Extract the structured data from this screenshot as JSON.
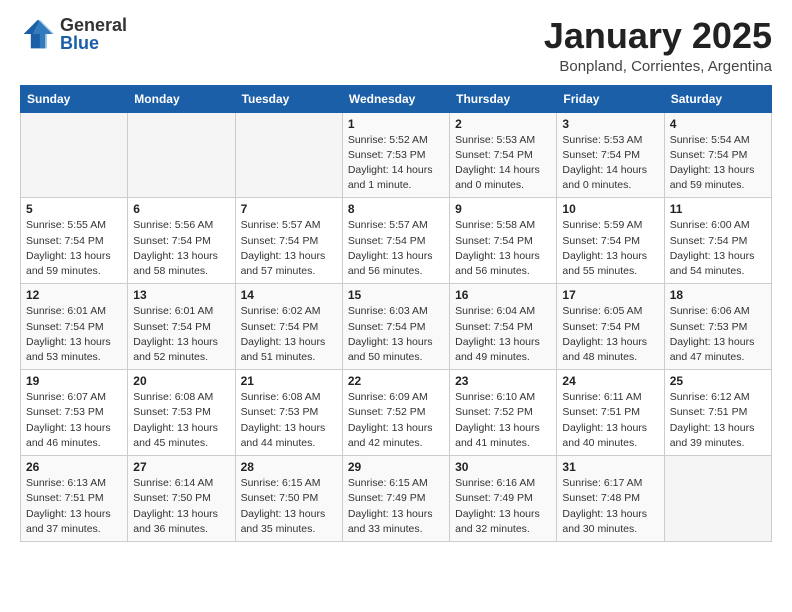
{
  "logo": {
    "general": "General",
    "blue": "Blue"
  },
  "header": {
    "month_year": "January 2025",
    "location": "Bonpland, Corrientes, Argentina"
  },
  "weekdays": [
    "Sunday",
    "Monday",
    "Tuesday",
    "Wednesday",
    "Thursday",
    "Friday",
    "Saturday"
  ],
  "weeks": [
    [
      {
        "day": "",
        "detail": ""
      },
      {
        "day": "",
        "detail": ""
      },
      {
        "day": "",
        "detail": ""
      },
      {
        "day": "1",
        "detail": "Sunrise: 5:52 AM\nSunset: 7:53 PM\nDaylight: 14 hours\nand 1 minute."
      },
      {
        "day": "2",
        "detail": "Sunrise: 5:53 AM\nSunset: 7:54 PM\nDaylight: 14 hours\nand 0 minutes."
      },
      {
        "day": "3",
        "detail": "Sunrise: 5:53 AM\nSunset: 7:54 PM\nDaylight: 14 hours\nand 0 minutes."
      },
      {
        "day": "4",
        "detail": "Sunrise: 5:54 AM\nSunset: 7:54 PM\nDaylight: 13 hours\nand 59 minutes."
      }
    ],
    [
      {
        "day": "5",
        "detail": "Sunrise: 5:55 AM\nSunset: 7:54 PM\nDaylight: 13 hours\nand 59 minutes."
      },
      {
        "day": "6",
        "detail": "Sunrise: 5:56 AM\nSunset: 7:54 PM\nDaylight: 13 hours\nand 58 minutes."
      },
      {
        "day": "7",
        "detail": "Sunrise: 5:57 AM\nSunset: 7:54 PM\nDaylight: 13 hours\nand 57 minutes."
      },
      {
        "day": "8",
        "detail": "Sunrise: 5:57 AM\nSunset: 7:54 PM\nDaylight: 13 hours\nand 56 minutes."
      },
      {
        "day": "9",
        "detail": "Sunrise: 5:58 AM\nSunset: 7:54 PM\nDaylight: 13 hours\nand 56 minutes."
      },
      {
        "day": "10",
        "detail": "Sunrise: 5:59 AM\nSunset: 7:54 PM\nDaylight: 13 hours\nand 55 minutes."
      },
      {
        "day": "11",
        "detail": "Sunrise: 6:00 AM\nSunset: 7:54 PM\nDaylight: 13 hours\nand 54 minutes."
      }
    ],
    [
      {
        "day": "12",
        "detail": "Sunrise: 6:01 AM\nSunset: 7:54 PM\nDaylight: 13 hours\nand 53 minutes."
      },
      {
        "day": "13",
        "detail": "Sunrise: 6:01 AM\nSunset: 7:54 PM\nDaylight: 13 hours\nand 52 minutes."
      },
      {
        "day": "14",
        "detail": "Sunrise: 6:02 AM\nSunset: 7:54 PM\nDaylight: 13 hours\nand 51 minutes."
      },
      {
        "day": "15",
        "detail": "Sunrise: 6:03 AM\nSunset: 7:54 PM\nDaylight: 13 hours\nand 50 minutes."
      },
      {
        "day": "16",
        "detail": "Sunrise: 6:04 AM\nSunset: 7:54 PM\nDaylight: 13 hours\nand 49 minutes."
      },
      {
        "day": "17",
        "detail": "Sunrise: 6:05 AM\nSunset: 7:54 PM\nDaylight: 13 hours\nand 48 minutes."
      },
      {
        "day": "18",
        "detail": "Sunrise: 6:06 AM\nSunset: 7:53 PM\nDaylight: 13 hours\nand 47 minutes."
      }
    ],
    [
      {
        "day": "19",
        "detail": "Sunrise: 6:07 AM\nSunset: 7:53 PM\nDaylight: 13 hours\nand 46 minutes."
      },
      {
        "day": "20",
        "detail": "Sunrise: 6:08 AM\nSunset: 7:53 PM\nDaylight: 13 hours\nand 45 minutes."
      },
      {
        "day": "21",
        "detail": "Sunrise: 6:08 AM\nSunset: 7:53 PM\nDaylight: 13 hours\nand 44 minutes."
      },
      {
        "day": "22",
        "detail": "Sunrise: 6:09 AM\nSunset: 7:52 PM\nDaylight: 13 hours\nand 42 minutes."
      },
      {
        "day": "23",
        "detail": "Sunrise: 6:10 AM\nSunset: 7:52 PM\nDaylight: 13 hours\nand 41 minutes."
      },
      {
        "day": "24",
        "detail": "Sunrise: 6:11 AM\nSunset: 7:51 PM\nDaylight: 13 hours\nand 40 minutes."
      },
      {
        "day": "25",
        "detail": "Sunrise: 6:12 AM\nSunset: 7:51 PM\nDaylight: 13 hours\nand 39 minutes."
      }
    ],
    [
      {
        "day": "26",
        "detail": "Sunrise: 6:13 AM\nSunset: 7:51 PM\nDaylight: 13 hours\nand 37 minutes."
      },
      {
        "day": "27",
        "detail": "Sunrise: 6:14 AM\nSunset: 7:50 PM\nDaylight: 13 hours\nand 36 minutes."
      },
      {
        "day": "28",
        "detail": "Sunrise: 6:15 AM\nSunset: 7:50 PM\nDaylight: 13 hours\nand 35 minutes."
      },
      {
        "day": "29",
        "detail": "Sunrise: 6:15 AM\nSunset: 7:49 PM\nDaylight: 13 hours\nand 33 minutes."
      },
      {
        "day": "30",
        "detail": "Sunrise: 6:16 AM\nSunset: 7:49 PM\nDaylight: 13 hours\nand 32 minutes."
      },
      {
        "day": "31",
        "detail": "Sunrise: 6:17 AM\nSunset: 7:48 PM\nDaylight: 13 hours\nand 30 minutes."
      },
      {
        "day": "",
        "detail": ""
      }
    ]
  ]
}
